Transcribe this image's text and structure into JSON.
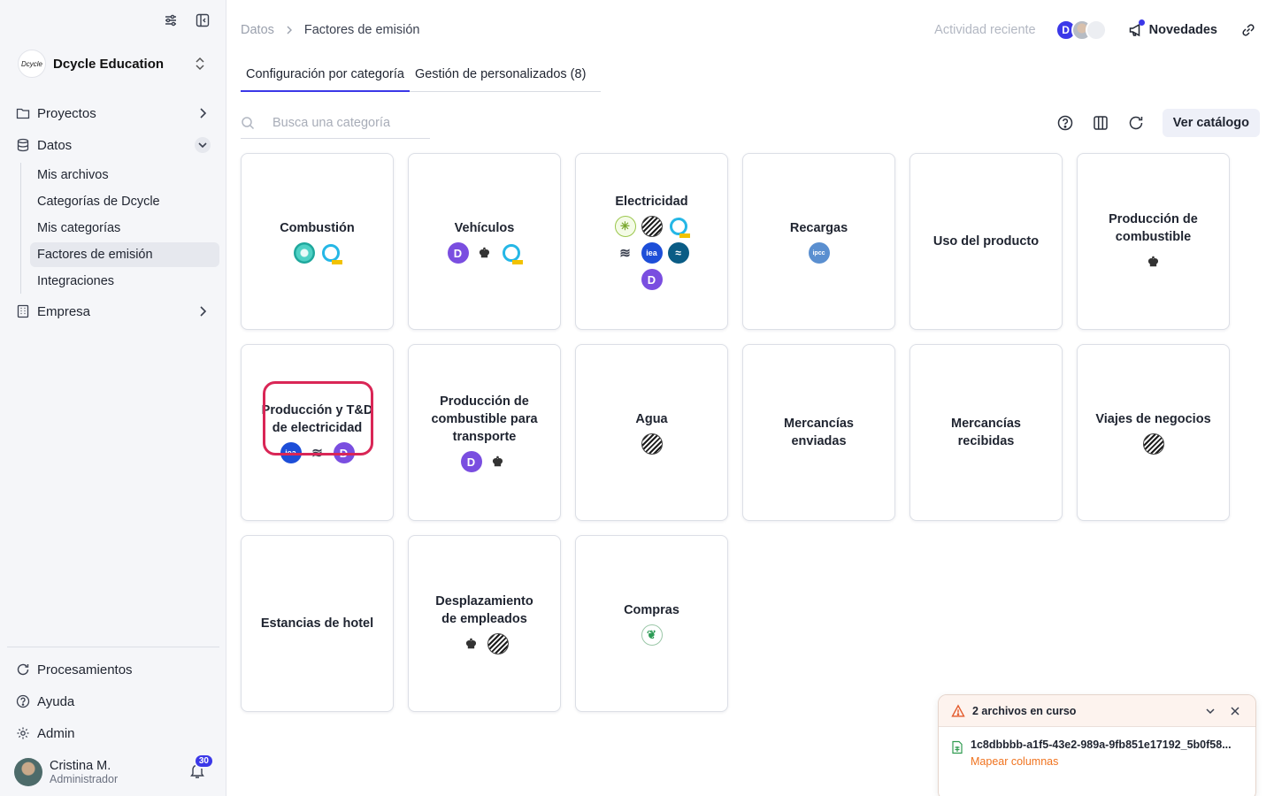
{
  "sidebar": {
    "org_logo_text": "Dcycle",
    "org_name": "Dcycle Education",
    "nav": [
      {
        "label": "Proyectos",
        "icon": "folder-icon"
      },
      {
        "label": "Datos",
        "icon": "database-icon",
        "expanded": true
      },
      {
        "label": "Empresa",
        "icon": "building-icon"
      }
    ],
    "datos_sub": [
      {
        "label": "Mis archivos"
      },
      {
        "label": "Categorías de Dcycle"
      },
      {
        "label": "Mis categorías"
      },
      {
        "label": "Factores de emisión",
        "active": true
      },
      {
        "label": "Integraciones"
      }
    ],
    "bottom": [
      {
        "label": "Procesamientos",
        "icon": "refresh-icon"
      },
      {
        "label": "Ayuda",
        "icon": "help-icon"
      },
      {
        "label": "Admin",
        "icon": "gear-icon"
      }
    ],
    "user": {
      "name": "Cristina M.",
      "role": "Administrador",
      "notifications": "30"
    }
  },
  "header": {
    "breadcrumb": [
      "Datos",
      "Factores de emisión"
    ],
    "recent_activity": "Actividad reciente",
    "avatar_initial": "D",
    "news": "Novedades"
  },
  "tabs": [
    {
      "label": "Configuración por categoría",
      "active": true
    },
    {
      "label": "Gestión de personalizados (8)",
      "active": false
    }
  ],
  "search": {
    "placeholder": "Busca una categoría"
  },
  "toolbar": {
    "catalog_button": "Ver catálogo"
  },
  "source_glyphs": {
    "dcycle": "D",
    "iea": "iea",
    "ipcc": "ipcc",
    "crest": "♚",
    "green": "✳",
    "db": "≋",
    "wave": "≈",
    "leaf": "❦"
  },
  "categories": [
    {
      "title": "Combustión",
      "sources": [
        "teal",
        "ring"
      ]
    },
    {
      "title": "Vehículos",
      "sources": [
        "dcycle",
        "crest",
        "ring"
      ]
    },
    {
      "title": "Electricidad",
      "sources": [
        "green",
        "spiral",
        "ring",
        "db",
        "iea",
        "wave",
        "dcycle"
      ]
    },
    {
      "title": "Recargas",
      "sources": [
        "ipcc"
      ]
    },
    {
      "title": "Uso del producto",
      "sources": []
    },
    {
      "title": "Producción de combustible",
      "sources": [
        "crest"
      ]
    },
    {
      "title": "Producción y T&D de electricidad",
      "sources": [
        "iea",
        "db",
        "dcycle"
      ],
      "highlighted": true
    },
    {
      "title": "Producción de combustible para transporte",
      "sources": [
        "dcycle",
        "crest"
      ]
    },
    {
      "title": "Agua",
      "sources": [
        "spiral"
      ]
    },
    {
      "title": "Mercancías enviadas",
      "sources": []
    },
    {
      "title": "Mercancías recibidas",
      "sources": []
    },
    {
      "title": "Viajes de negocios",
      "sources": [
        "spiral"
      ]
    },
    {
      "title": "Estancias de hotel",
      "sources": []
    },
    {
      "title": "Desplazamiento de empleados",
      "sources": [
        "crest",
        "spiral"
      ]
    },
    {
      "title": "Compras",
      "sources": [
        "leaf"
      ]
    }
  ],
  "toast": {
    "title": "2 archivos en curso",
    "file_name": "1c8dbbbb-a1f5-43e2-989a-9fb851e17192_5b0f58...",
    "action": "Mapear columnas"
  }
}
